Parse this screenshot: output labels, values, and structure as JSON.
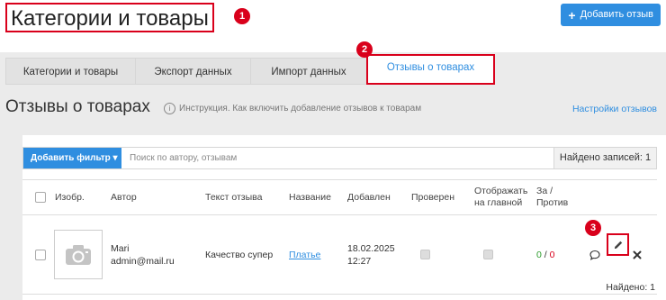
{
  "header": {
    "title": "Категории и товары",
    "add_review_label": "Добавить отзыв",
    "add_review_icon": "plus-icon"
  },
  "markers": [
    "1",
    "2",
    "3"
  ],
  "tabs": [
    {
      "label": "Категории и товары"
    },
    {
      "label": "Экспорт данных"
    },
    {
      "label": "Импорт данных"
    },
    {
      "label": "Отзывы о товарах",
      "active": true
    }
  ],
  "section": {
    "title": "Отзывы о товарах",
    "instruction": "Инструкция. Как включить добавление отзывов к товарам",
    "settings_link": "Настройки отзывов"
  },
  "filter": {
    "add_filter_label": "Добавить фильтр ▾",
    "search_placeholder": "Поиск по автору, отзывам",
    "found_records": "Найдено записей: 1"
  },
  "table": {
    "headers": {
      "image": "Изобр.",
      "author": "Автор",
      "text": "Текст отзыва",
      "name": "Название",
      "added": "Добавлен",
      "checked": "Проверен",
      "show_main_1": "Отображать",
      "show_main_2": "на главной",
      "votes_1": "За /",
      "votes_2": "Против"
    },
    "rows": [
      {
        "author_name": "Mari",
        "author_email": "admin@mail.ru",
        "text": "Качество супер",
        "product": "Платье",
        "date": "18.02.2025",
        "time": "12:27",
        "votes_for": "0",
        "votes_sep": " / ",
        "votes_against": "0"
      }
    ]
  },
  "footer": {
    "found": "Найдено: 1"
  },
  "colors": {
    "accent": "#2f8ee0",
    "highlight": "#d9001b",
    "positive": "#2a9b2a"
  }
}
